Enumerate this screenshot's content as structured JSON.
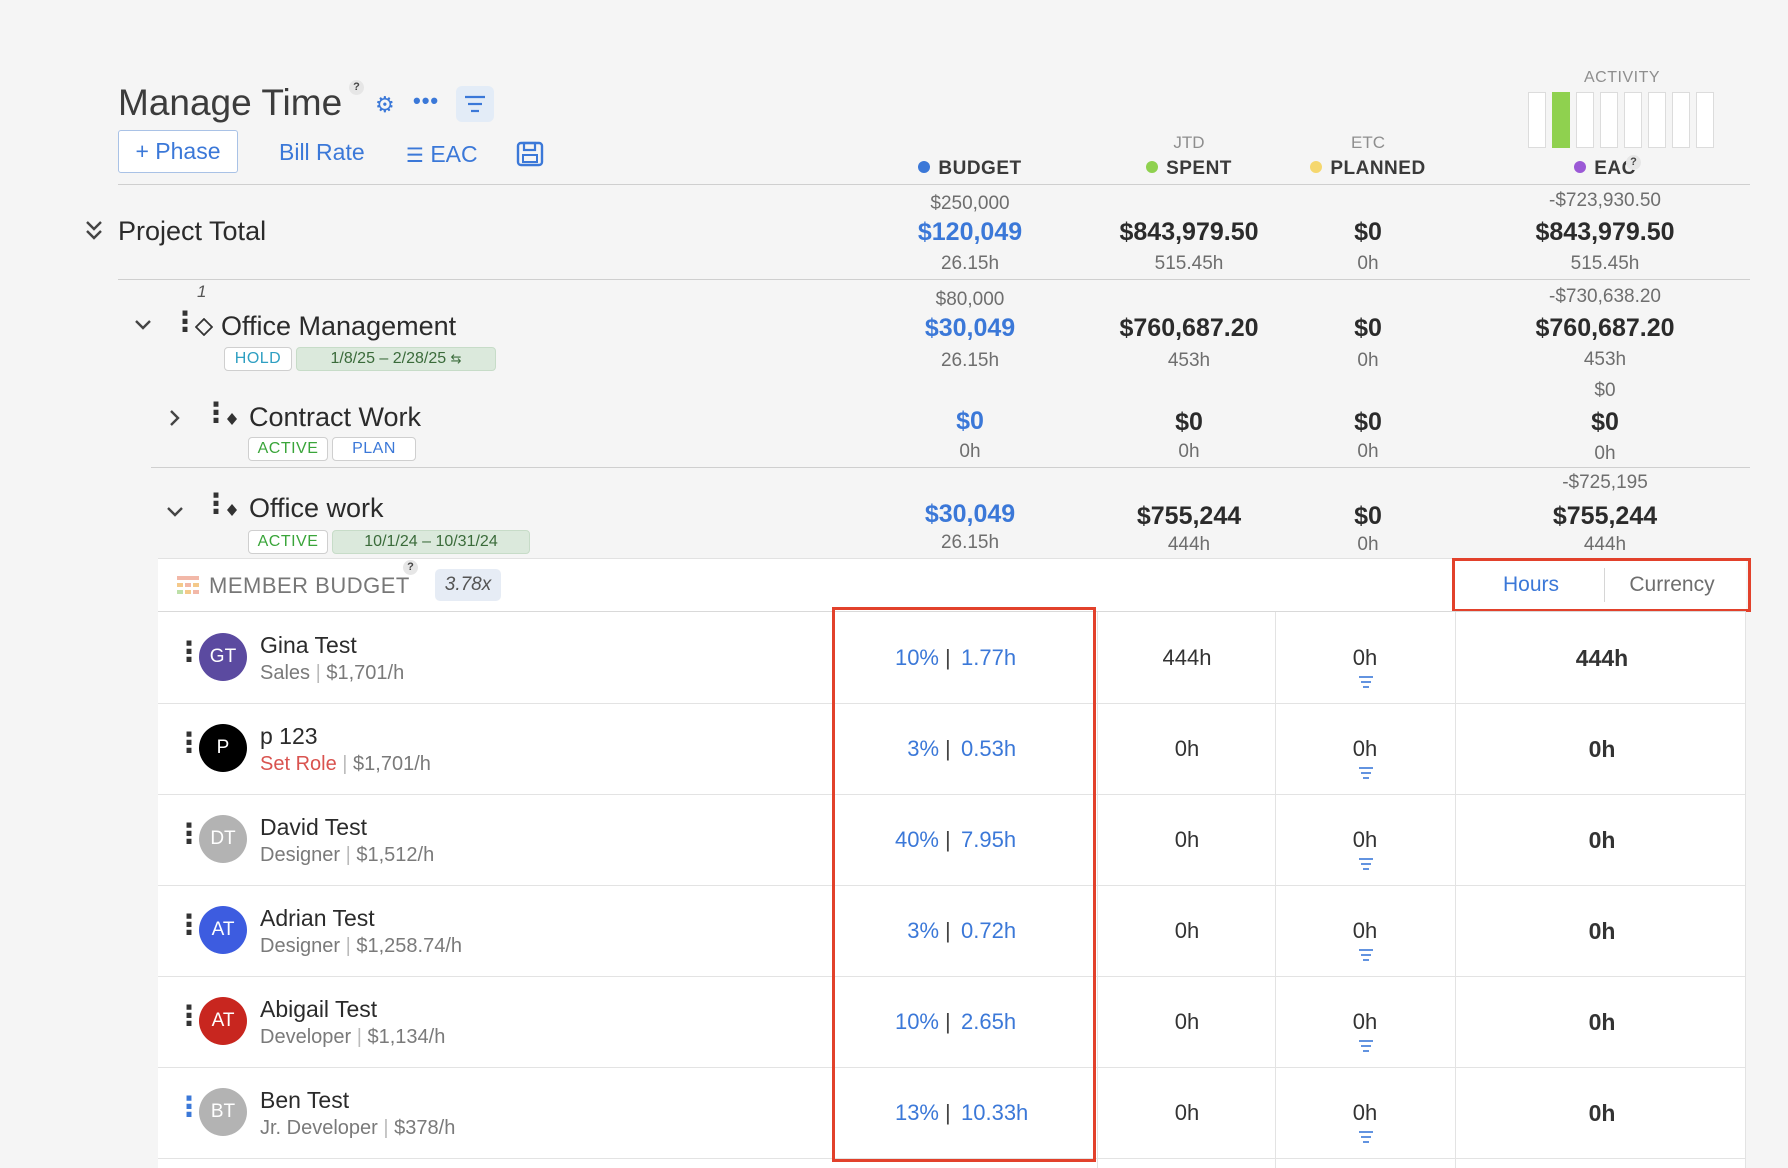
{
  "header": {
    "title": "Manage Time",
    "help": "?",
    "phase_button": "+ Phase",
    "bill_rate": "Bill Rate",
    "eac_link": "EAC"
  },
  "activity": {
    "label": "ACTIVITY",
    "bars": [
      false,
      true,
      false,
      false,
      false,
      false,
      false,
      false
    ],
    "active_color": "#8fd14f"
  },
  "columns": {
    "budget": {
      "label": "BUDGET",
      "color": "#3b78d8"
    },
    "spent": {
      "sub": "JTD",
      "label": "SPENT",
      "color": "#8fd14f"
    },
    "planned": {
      "sub": "ETC",
      "label": "PLANNED",
      "color": "#f5d76e"
    },
    "eac": {
      "label": "EAC",
      "color": "#9b59d6",
      "help": "?"
    }
  },
  "project_total": {
    "name": "Project Total",
    "budget_top": "$250,000",
    "budget": "$120,049",
    "budget_hours": "26.15h",
    "spent": "$843,979.50",
    "spent_hours": "515.45h",
    "planned": "$0",
    "planned_hours": "0h",
    "eac_top": "-$723,930.50",
    "eac": "$843,979.50",
    "eac_hours": "515.45h"
  },
  "phase": {
    "index": "1",
    "name": "Office Management",
    "status": "HOLD",
    "dates": "1/8/25   –  2/28/25",
    "budget_top": "$80,000",
    "budget": "$30,049",
    "budget_hours": "26.15h",
    "spent": "$760,687.20",
    "spent_hours": "453h",
    "planned": "$0",
    "planned_hours": "0h",
    "eac_top": "-$730,638.20",
    "eac": "$760,687.20",
    "eac_hours": "453h"
  },
  "contract_work": {
    "name": "Contract Work",
    "status": "ACTIVE",
    "status2": "PLAN",
    "budget": "$0",
    "budget_hours": "0h",
    "spent": "$0",
    "spent_hours": "0h",
    "planned": "$0",
    "planned_hours": "0h",
    "eac_top": "$0",
    "eac": "$0",
    "eac_hours": "0h"
  },
  "office_work": {
    "name": "Office work",
    "status": "ACTIVE",
    "dates": "10/1/24   – 10/31/24",
    "budget": "$30,049",
    "budget_hours": "26.15h",
    "spent": "$755,244",
    "spent_hours": "444h",
    "planned": "$0",
    "planned_hours": "0h",
    "eac_top": "-$725,195",
    "eac": "$755,244",
    "eac_hours": "444h"
  },
  "member_budget": {
    "label": "MEMBER BUDGET",
    "help": "?",
    "multiplier": "3.78x",
    "toggle_hours": "Hours",
    "toggle_currency": "Currency",
    "members": [
      {
        "initials": "GT",
        "color": "#5b4aa0",
        "name": "Gina Test",
        "role": "Sales",
        "role_warn": false,
        "rate": "$1,701/h",
        "pct": "10%",
        "hours": "1.77h",
        "spent": "444h",
        "planned": "0h",
        "eac": "444h"
      },
      {
        "initials": "P",
        "color": "#000000",
        "name": "p 123",
        "role": "Set Role",
        "role_warn": true,
        "rate": "$1,701/h",
        "pct": "3%",
        "hours": "0.53h",
        "spent": "0h",
        "planned": "0h",
        "eac": "0h"
      },
      {
        "initials": "DT",
        "color": "#b3b3b3",
        "name": "David Test",
        "role": "Designer",
        "role_warn": false,
        "rate": "$1,512/h",
        "pct": "40%",
        "hours": "7.95h",
        "spent": "0h",
        "planned": "0h",
        "eac": "0h"
      },
      {
        "initials": "AT",
        "color": "#3d5ce0",
        "name": "Adrian Test",
        "role": "Designer",
        "role_warn": false,
        "rate": "$1,258.74/h",
        "pct": "3%",
        "hours": "0.72h",
        "spent": "0h",
        "planned": "0h",
        "eac": "0h"
      },
      {
        "initials": "AT",
        "color": "#c8261f",
        "name": "Abigail Test",
        "role": "Developer",
        "role_warn": false,
        "rate": "$1,134/h",
        "pct": "10%",
        "hours": "2.65h",
        "spent": "0h",
        "planned": "0h",
        "eac": "0h"
      },
      {
        "initials": "BT",
        "color": "#b3b3b3",
        "name": "Ben Test",
        "role": "Jr. Developer",
        "role_warn": false,
        "rate": "$378/h",
        "pct": "13%",
        "hours": "10.33h",
        "spent": "0h",
        "planned": "0h",
        "eac": "0h"
      }
    ]
  }
}
